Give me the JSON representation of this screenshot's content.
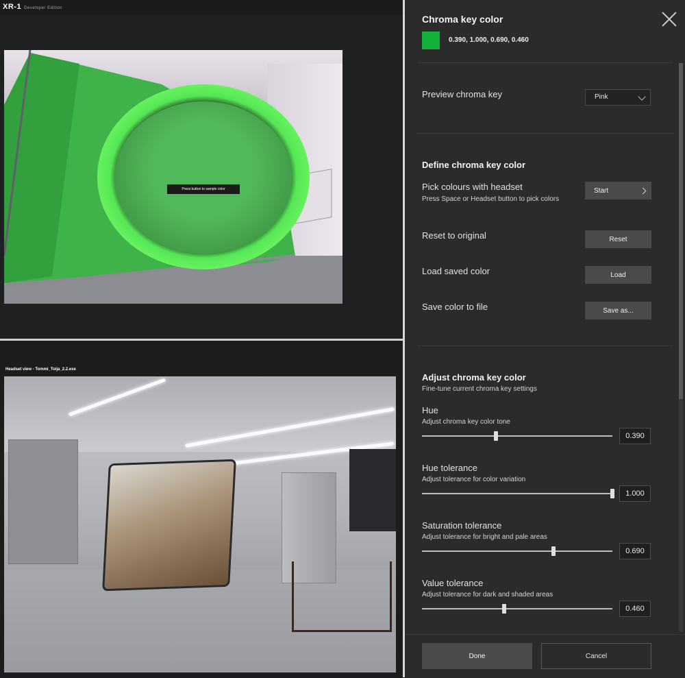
{
  "app": {
    "title": "XR-1",
    "edition": "Developer Edition"
  },
  "camera": {
    "sample_tooltip": "Press button to sample color"
  },
  "headset": {
    "title": "Headset view - Tommi_Toija_2.2.exe"
  },
  "panel": {
    "chroma_key_color": {
      "heading": "Chroma key color",
      "swatch_color": "#13b23a",
      "value": "0.390, 1.000, 0.690, 0.460"
    },
    "preview": {
      "label": "Preview chroma key",
      "selected": "Pink"
    },
    "define": {
      "heading": "Define chroma key color",
      "pick_label": "Pick colours with headset",
      "pick_hint": "Press Space or Headset button to pick colors",
      "start_button": "Start",
      "reset_label": "Reset to original",
      "reset_button": "Reset",
      "load_label": "Load saved color",
      "load_button": "Load",
      "save_label": "Save color to file",
      "save_button": "Save as..."
    },
    "adjust": {
      "heading": "Adjust chroma key color",
      "subheading": "Fine-tune current chroma key settings",
      "sliders": [
        {
          "label": "Hue",
          "hint": "Adjust chroma key color tone",
          "value": "0.390",
          "fraction": 0.39
        },
        {
          "label": "Hue tolerance",
          "hint": "Adjust tolerance for color variation",
          "value": "1.000",
          "fraction": 1.0
        },
        {
          "label": "Saturation tolerance",
          "hint": "Adjust tolerance for bright and pale areas",
          "value": "0.690",
          "fraction": 0.69
        },
        {
          "label": "Value tolerance",
          "hint": "Adjust tolerance for dark and shaded areas",
          "value": "0.460",
          "fraction": 0.43
        }
      ]
    },
    "footer": {
      "done": "Done",
      "cancel": "Cancel"
    }
  }
}
